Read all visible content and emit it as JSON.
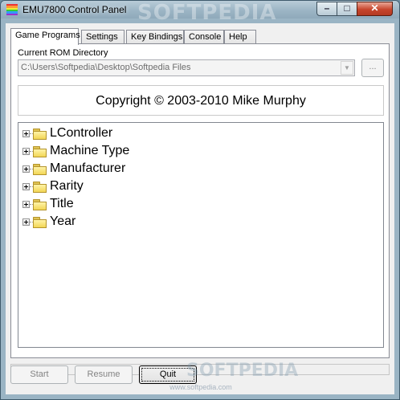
{
  "window": {
    "title": "EMU7800 Control Panel",
    "watermark": "SOFTPEDIA",
    "buttons": {
      "minimize": "–",
      "maximize": "□",
      "close": "✕"
    }
  },
  "tabs": [
    {
      "label": "Game Programs",
      "active": true
    },
    {
      "label": "Settings",
      "active": false
    },
    {
      "label": "Key Bindings",
      "active": false
    },
    {
      "label": "Console",
      "active": false
    },
    {
      "label": "Help",
      "active": false
    }
  ],
  "rom": {
    "label": "Current ROM Directory",
    "value": "C:\\Users\\Softpedia\\Desktop\\Softpedia Files",
    "browse_label": "...",
    "dropdown_arrow": "▼"
  },
  "copyright": "Copyright © 2003-2010 Mike Murphy",
  "tree": {
    "items": [
      {
        "label": "LController"
      },
      {
        "label": "Machine Type"
      },
      {
        "label": "Manufacturer"
      },
      {
        "label": "Rarity"
      },
      {
        "label": "Title"
      },
      {
        "label": "Year"
      }
    ]
  },
  "status": "",
  "footer": {
    "start_label": "Start",
    "resume_label": "Resume",
    "quit_label": "Quit",
    "watermark": "SOFTPEDIA",
    "url": "www.softpedia.com"
  },
  "colors": {
    "title_gradient": "#9cb5c5",
    "close_button": "#c7452c",
    "folder": "#f2d655"
  }
}
